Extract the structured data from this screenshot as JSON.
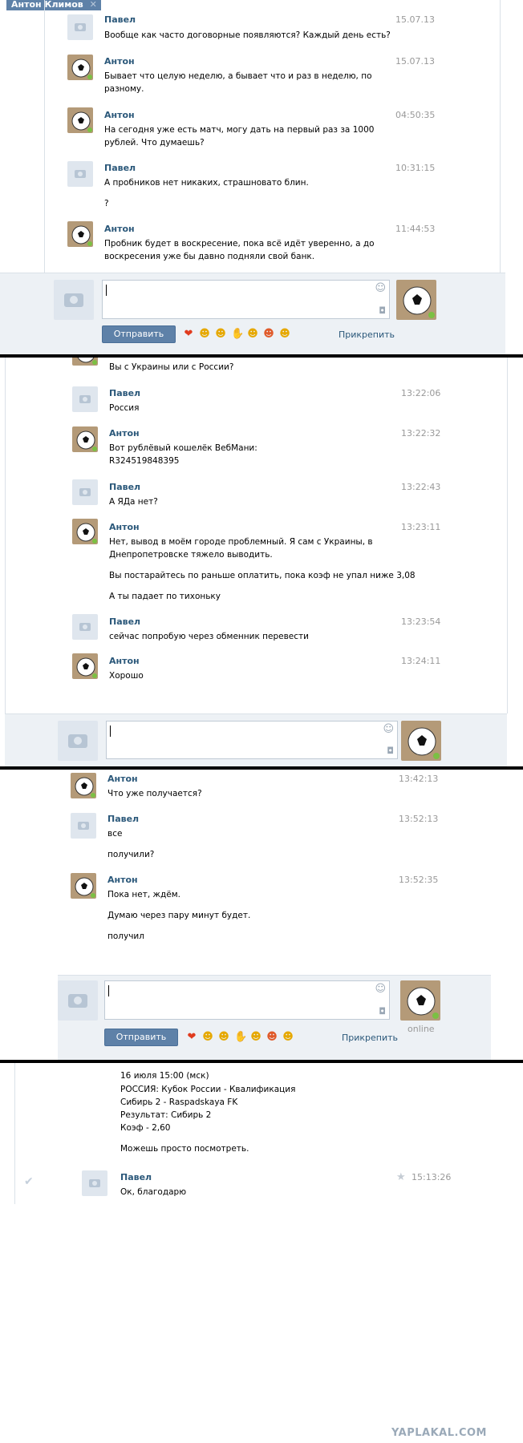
{
  "tab": {
    "title": "Антон Климов"
  },
  "panel1": {
    "messages": [
      {
        "name": "Павел",
        "time": "15.07.13",
        "avatar": "camera",
        "lines": [
          "Вообще как часто договорные появляются? Каждый день есть?"
        ]
      },
      {
        "name": "Антон",
        "time": "15.07.13",
        "avatar": "ball",
        "lines": [
          "Бывает что целую неделю, а бывает что и раз в неделю, по",
          "разному."
        ]
      },
      {
        "name": "Антон",
        "time": "04:50:35",
        "avatar": "ball",
        "lines": [
          "На сегодня уже есть матч, могу дать на первый раз за 1000",
          "рублей. Что думаешь?"
        ]
      },
      {
        "name": "Павел",
        "time": "10:31:15",
        "avatar": "camera",
        "lines": [
          "А пробников нет никаких, страшновато блин.",
          "?"
        ]
      },
      {
        "name": "Антон",
        "time": "11:44:53",
        "avatar": "ball",
        "lines": [
          "Пробник будет в воскресение, пока всё идёт уверенно, а до",
          "воскресения уже бы давно подняли свой банк."
        ]
      }
    ],
    "send_label": "Отправить",
    "attach_label": "Прикрепить"
  },
  "panel2": {
    "top_line": "Вы с Украины или с России?",
    "messages": [
      {
        "name": "Павел",
        "time": "13:22:06",
        "avatar": "camera",
        "lines": [
          "Россия"
        ]
      },
      {
        "name": "Антон",
        "time": "13:22:32",
        "avatar": "ball",
        "lines": [
          "Вот рублёвый кошелёк ВебМани:",
          "R324519848395"
        ]
      },
      {
        "name": "Павел",
        "time": "13:22:43",
        "avatar": "camera",
        "lines": [
          "А ЯДа нет?"
        ]
      },
      {
        "name": "Антон",
        "time": "13:23:11",
        "avatar": "ball",
        "lines": [
          "Нет, вывод в моём городе проблемный. Я сам с Украины, в",
          "Днепропетровске тяжело выводить.",
          "Вы постарайтесь по раньше оплатить, пока коэф не упал ниже 3,08",
          "А ты падает по тихоньку"
        ]
      },
      {
        "name": "Павел",
        "time": "13:23:54",
        "avatar": "camera",
        "lines": [
          "сейчас попробую через обменник перевести"
        ]
      },
      {
        "name": "Антон",
        "time": "13:24:11",
        "avatar": "ball",
        "lines": [
          "Хорошо"
        ]
      }
    ]
  },
  "panel3": {
    "messages": [
      {
        "name": "Антон",
        "time": "13:42:13",
        "avatar": "ball",
        "lines": [
          "Что уже получается?"
        ]
      },
      {
        "name": "Павел",
        "time": "13:52:13",
        "avatar": "camera",
        "lines": [
          "все",
          "получили?"
        ]
      },
      {
        "name": "Антон",
        "time": "13:52:35",
        "avatar": "ball",
        "lines": [
          "Пока нет, ждём.",
          "Думаю через пару минут будет.",
          "получил"
        ]
      }
    ],
    "send_label": "Отправить",
    "attach_label": "Прикрепить",
    "online_label": "online"
  },
  "panel4": {
    "lines": [
      "16 июля 15:00 (мск)",
      "РОССИЯ: Кубок России - Квалификация",
      "Сибирь 2 - Raspadskaya FK",
      "Результат: Сибирь 2",
      "Коэф - 2,60",
      "Можешь просто посмотреть."
    ],
    "message": {
      "name": "Павел",
      "time": "15:13:26",
      "lines": [
        "Ок, благодарю"
      ]
    }
  },
  "watermark": "YAPLAKAL.COM",
  "icons": {
    "emoji": [
      "heart",
      "tongue",
      "smirk",
      "thumbs-down",
      "kiss",
      "heart-eyes",
      "neutral"
    ]
  }
}
